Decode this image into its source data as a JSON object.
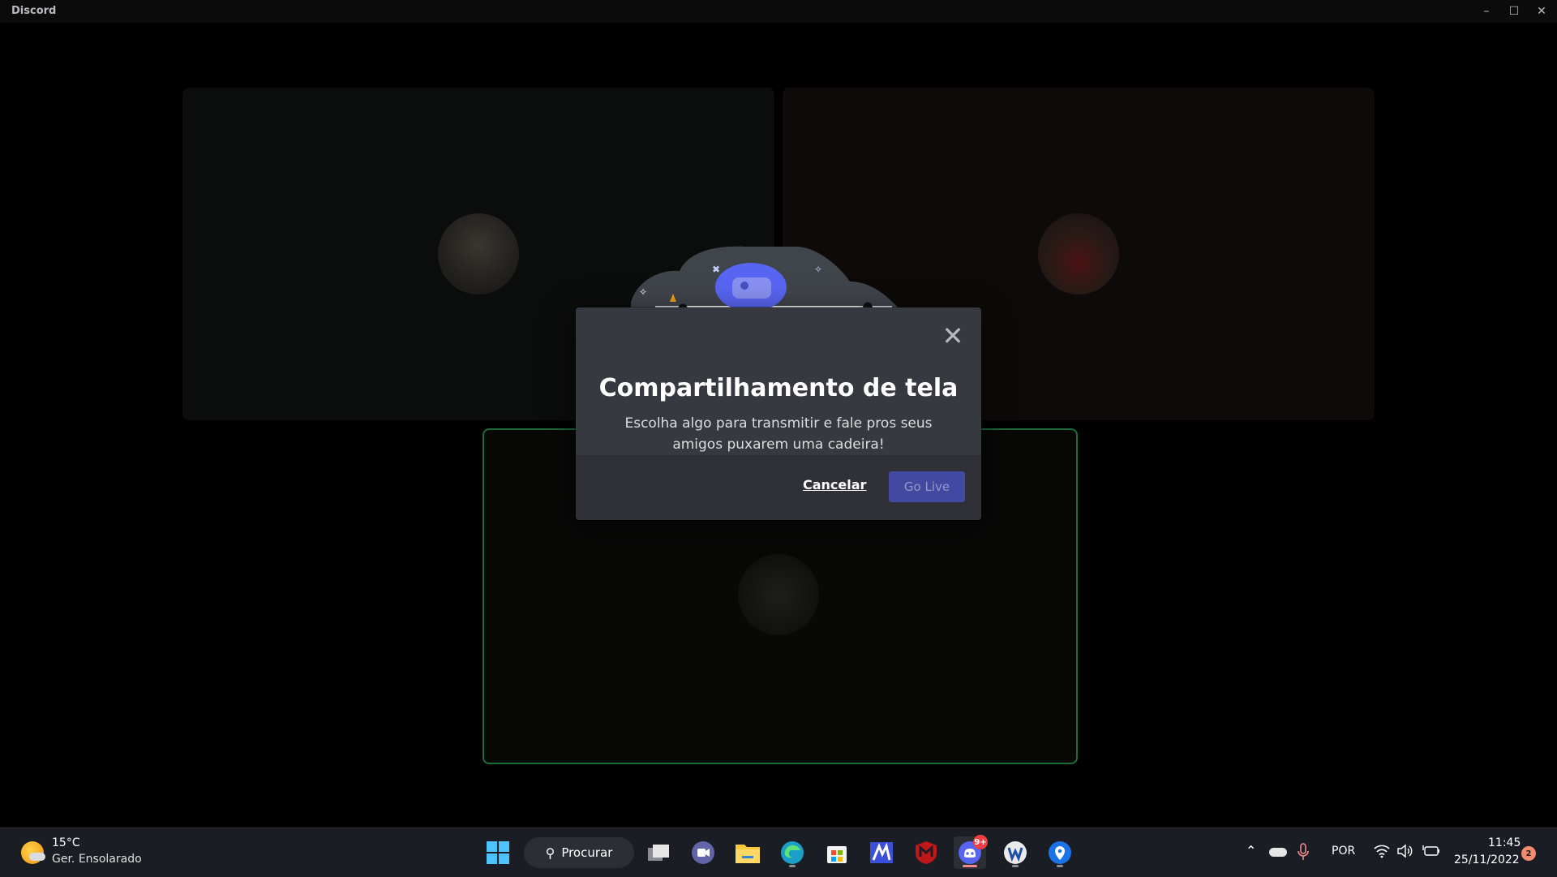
{
  "window": {
    "title": "Discord",
    "minimize_icon": "minimize-icon",
    "maximize_icon": "maximize-icon",
    "close_icon": "close-icon"
  },
  "call": {
    "tiles": [
      {
        "name": "participant-1",
        "background": "#0b0d0c"
      },
      {
        "name": "participant-2",
        "background": "#0e0a0a"
      },
      {
        "name": "participant-3-speaking",
        "background": "#080907",
        "border": "#1f6b3a"
      }
    ]
  },
  "modal": {
    "title": "Compartilhamento de tela",
    "subtitle": "Escolha algo para transmitir e fale pros seus amigos puxarem uma cadeira!",
    "cancel_label": "Cancelar",
    "golive_label": "Go Live",
    "close_icon": "close-icon",
    "accent": "#5865f2"
  },
  "taskbar": {
    "weather": {
      "temp": "15°C",
      "condition": "Ger. Ensolarado",
      "icon": "sun-cloud-icon"
    },
    "search_label": "Procurar",
    "apps": [
      {
        "name": "start-button",
        "icon": "windows-logo-icon"
      },
      {
        "name": "task-view",
        "icon": "task-view-icon"
      },
      {
        "name": "teams-chat",
        "icon": "video-chat-icon"
      },
      {
        "name": "file-explorer",
        "icon": "folder-icon"
      },
      {
        "name": "edge-browser",
        "icon": "edge-icon"
      },
      {
        "name": "microsoft-store",
        "icon": "store-icon"
      },
      {
        "name": "app-blue-m",
        "icon": "m-logo-icon"
      },
      {
        "name": "mcafee",
        "icon": "mcafee-shield-icon"
      },
      {
        "name": "discord",
        "icon": "discord-icon",
        "badge": "9+"
      },
      {
        "name": "app-w",
        "icon": "w-logo-icon"
      },
      {
        "name": "maps",
        "icon": "location-pin-icon"
      }
    ],
    "tray": {
      "language": "POR",
      "time": "11:45",
      "date": "25/11/2022",
      "notifications": "2"
    }
  }
}
